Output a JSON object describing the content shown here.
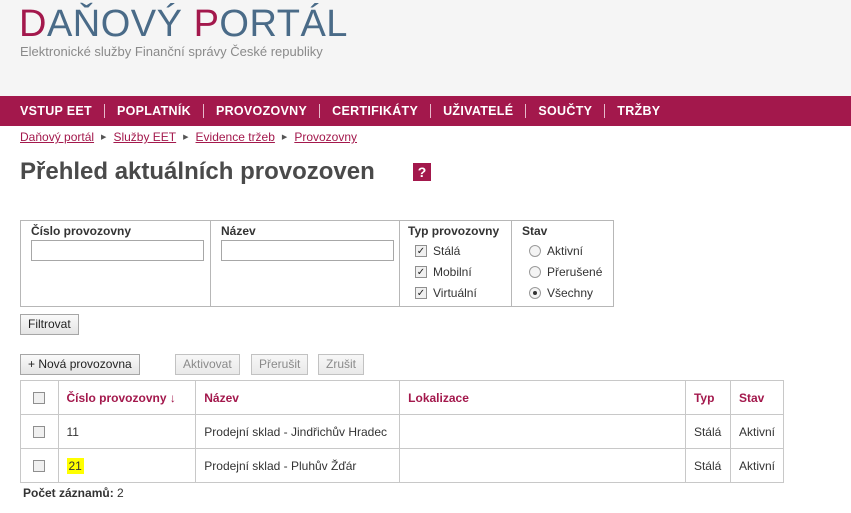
{
  "header": {
    "logo_a_accent": "D",
    "logo_a_rest": "AŇOVÝ ",
    "logo_b_accent": "P",
    "logo_b_rest": "ORTÁL",
    "subtitle": "Elektronické služby Finanční správy České republiky"
  },
  "nav": {
    "items": [
      "VSTUP EET",
      "POPLATNÍK",
      "PROVOZOVNY",
      "CERTIFIKÁTY",
      "UŽIVATELÉ",
      "SOUČTY",
      "TRŽBY"
    ]
  },
  "breadcrumb": [
    "Daňový portál",
    "Služby EET",
    "Evidence tržeb",
    "Provozovny"
  ],
  "page": {
    "title": "Přehled aktuálních provozoven",
    "help_label": "?"
  },
  "filter": {
    "number_label": "Číslo provozovny",
    "number_value": "",
    "name_label": "Název",
    "name_value": "",
    "type_label": "Typ provozovny",
    "type_options": [
      {
        "label": "Stálá",
        "checked": true
      },
      {
        "label": "Mobilní",
        "checked": true
      },
      {
        "label": "Virtuální",
        "checked": true
      }
    ],
    "state_label": "Stav",
    "state_options": [
      {
        "label": "Aktivní",
        "selected": false
      },
      {
        "label": "Přerušené",
        "selected": false
      },
      {
        "label": "Všechny",
        "selected": true
      }
    ],
    "submit_label": "Filtrovat"
  },
  "toolbar": {
    "new_label": "+ Nová provozovna",
    "activate_label": "Aktivovat",
    "interrupt_label": "Přerušit",
    "cancel_label": "Zrušit"
  },
  "table": {
    "headers": {
      "number": "Číslo provozovny ↓",
      "name": "Název",
      "location": "Lokalizace",
      "type": "Typ",
      "state": "Stav"
    },
    "rows": [
      {
        "number": "11",
        "name": "Prodejní sklad - Jindřichův Hradec",
        "location": "",
        "type": "Stálá",
        "state": "Aktivní"
      },
      {
        "number": "21",
        "name": "Prodejní sklad - Pluhův Žďár",
        "location": "",
        "type": "Stálá",
        "state": "Aktivní"
      }
    ]
  },
  "footer": {
    "count_label": "Počet záznamů:",
    "count_value": "2"
  },
  "colors": {
    "brand": "#a3184c",
    "logo_blue": "#4a6b88",
    "highlight": "#ffff00"
  }
}
